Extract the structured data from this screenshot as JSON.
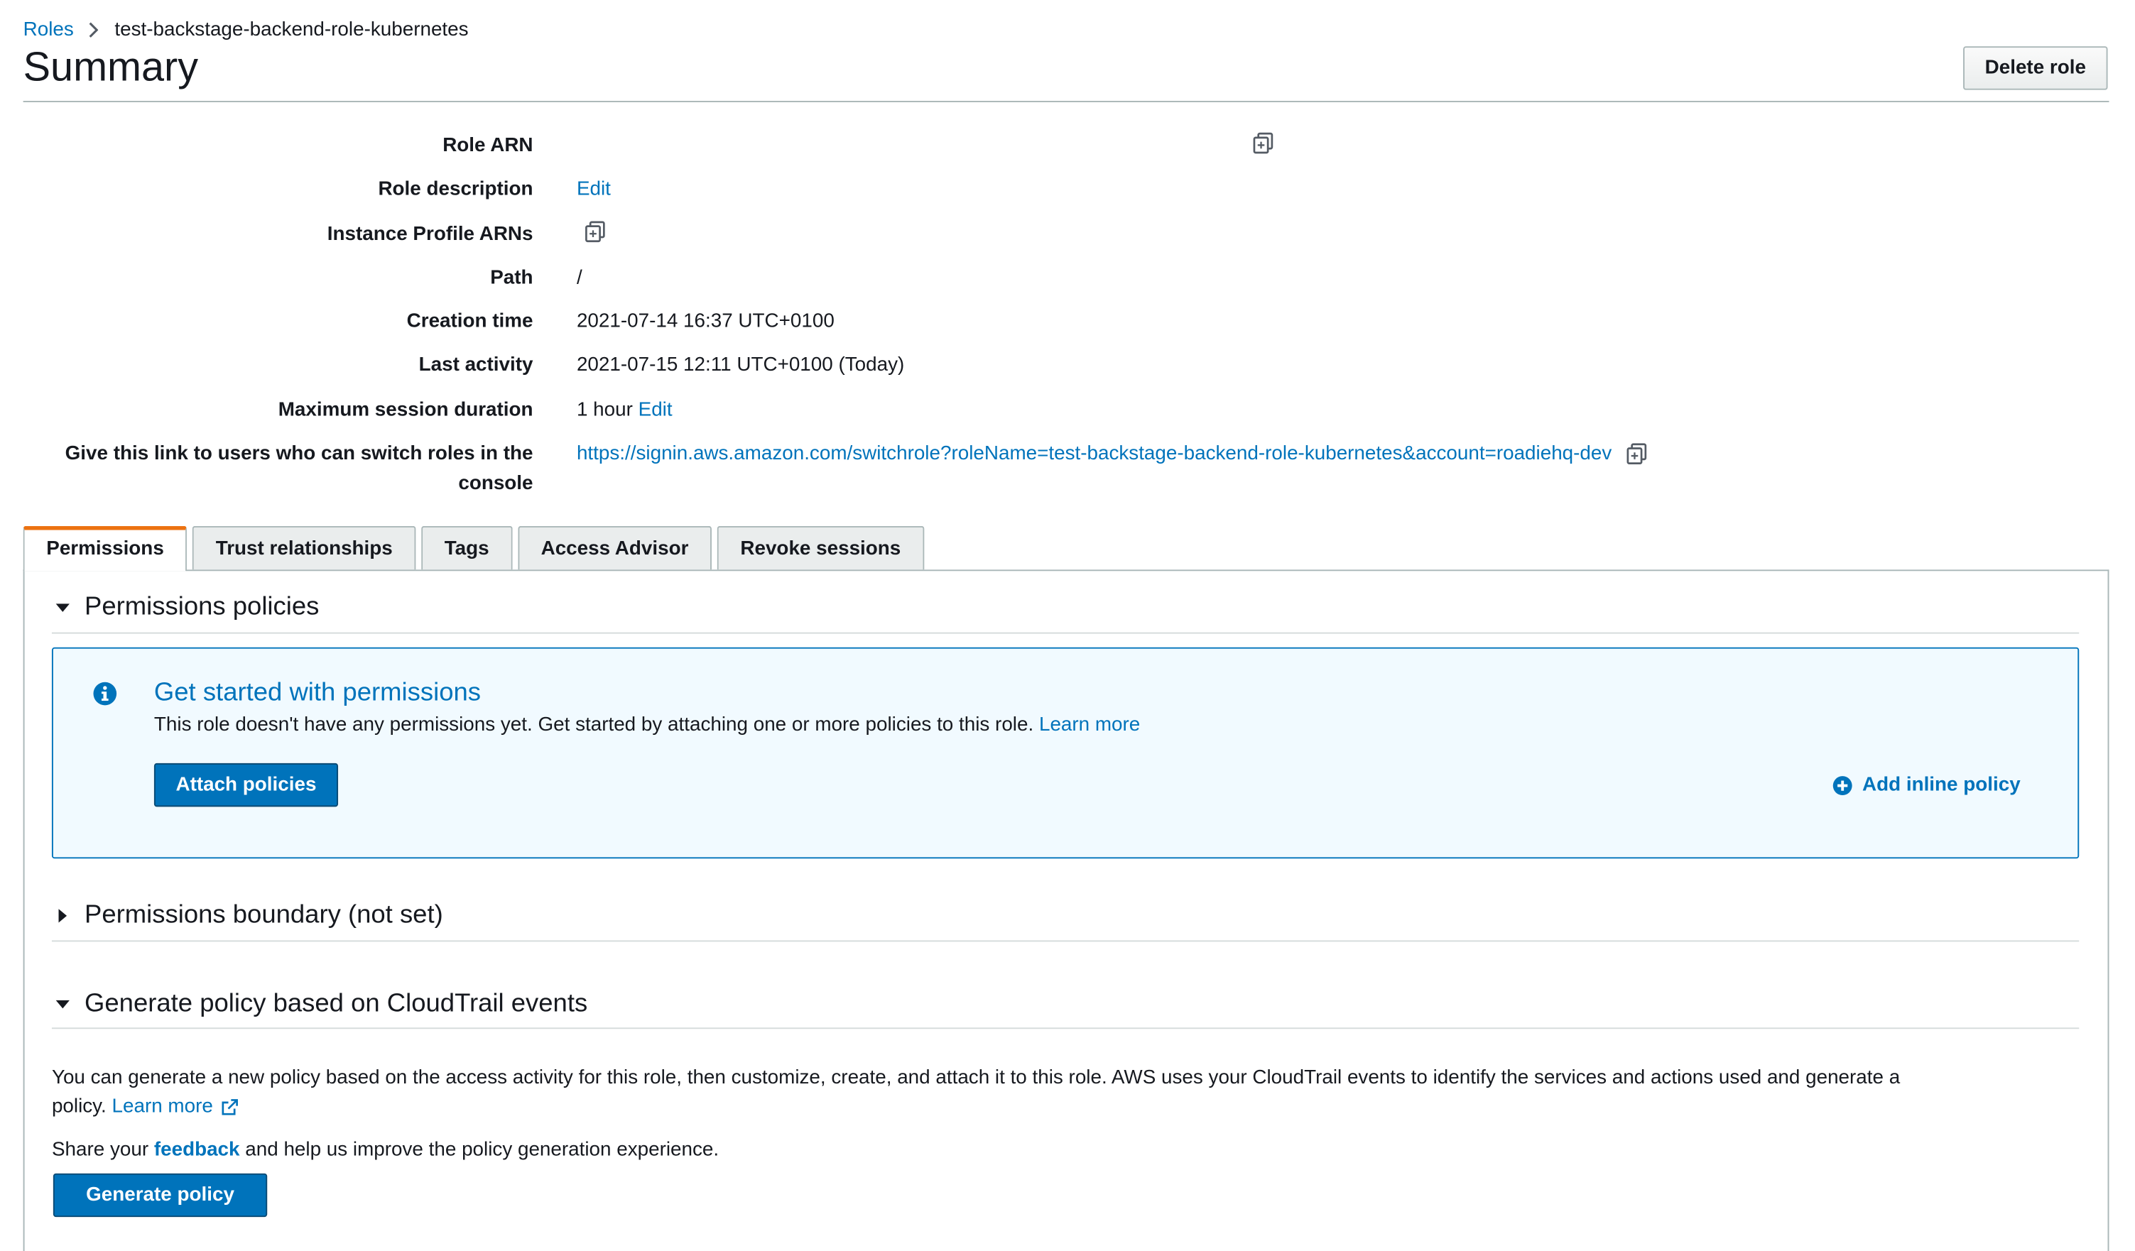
{
  "breadcrumb": {
    "parent": "Roles",
    "current": "test-backstage-backend-role-kubernetes"
  },
  "header": {
    "title": "Summary",
    "delete_label": "Delete role"
  },
  "summary": {
    "role_arn_label": "Role ARN",
    "role_description_label": "Role description",
    "role_description_edit": "Edit",
    "instance_profile_label": "Instance Profile ARNs",
    "path_label": "Path",
    "path_value": "/",
    "creation_label": "Creation time",
    "creation_value": "2021-07-14 16:37 UTC+0100",
    "last_activity_label": "Last activity",
    "last_activity_value": "2021-07-15 12:11 UTC+0100 (Today)",
    "max_session_label": "Maximum session duration",
    "max_session_value": "1 hour",
    "max_session_edit": "Edit",
    "switch_link_label_line1": "Give this link to users who can switch roles in the",
    "switch_link_label_line2": "console",
    "switch_link_value": "https://signin.aws.amazon.com/switchrole?roleName=test-backstage-backend-role-kubernetes&account=roadiehq-dev"
  },
  "tabs": [
    {
      "label": "Permissions",
      "active": true
    },
    {
      "label": "Trust relationships"
    },
    {
      "label": "Tags"
    },
    {
      "label": "Access Advisor"
    },
    {
      "label": "Revoke sessions"
    }
  ],
  "permissions": {
    "policies_heading": "Permissions policies",
    "info_title": "Get started with permissions",
    "info_text": "This role doesn't have any permissions yet. Get started by attaching one or more policies to this role.",
    "info_learn_more": "Learn more",
    "attach_label": "Attach policies",
    "add_inline_label": "Add inline policy",
    "boundary_heading": "Permissions boundary (not set)",
    "generate_heading": "Generate policy based on CloudTrail events",
    "generate_text_1": "You can generate a new policy based on the access activity for this role, then customize, create, and attach it to this role. AWS uses your CloudTrail events to identify the services and actions used and generate a",
    "generate_text_2": "policy.",
    "generate_learn_more": "Learn more",
    "share_prefix": "Share your",
    "share_link": "feedback",
    "share_suffix": "and help us improve the policy generation experience.",
    "generate_button": "Generate policy"
  },
  "colors": {
    "link": "#0073bb",
    "accent_tab": "#ec7211",
    "info_bg": "#f1faff"
  }
}
